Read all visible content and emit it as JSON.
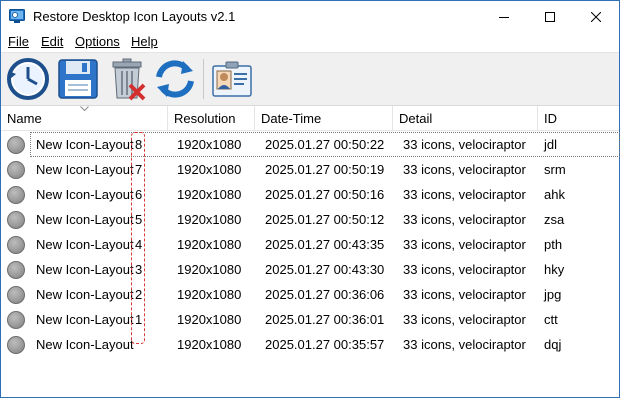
{
  "window": {
    "title": "Restore Desktop Icon Layouts v2.1"
  },
  "menu": {
    "file": "File",
    "edit": "Edit",
    "options": "Options",
    "help": "Help"
  },
  "toolbar": {
    "items": [
      "clock-restore-icon",
      "save-icon",
      "delete-icon",
      "refresh-icon",
      "id-card-icon"
    ]
  },
  "columns": {
    "name": "Name",
    "resolution": "Resolution",
    "datetime": "Date-Time",
    "detail": "Detail",
    "id": "ID"
  },
  "rows": [
    {
      "name": "New Icon-Layout",
      "num": "8",
      "resolution": "1920x1080",
      "datetime": "2025.01.27 00:50:22",
      "detail": "33 icons, velociraptor",
      "id": "jdl"
    },
    {
      "name": "New Icon-Layout",
      "num": "7",
      "resolution": "1920x1080",
      "datetime": "2025.01.27 00:50:19",
      "detail": "33 icons, velociraptor",
      "id": "srm"
    },
    {
      "name": "New Icon-Layout",
      "num": "6",
      "resolution": "1920x1080",
      "datetime": "2025.01.27 00:50:16",
      "detail": "33 icons, velociraptor",
      "id": "ahk"
    },
    {
      "name": "New Icon-Layout",
      "num": "5",
      "resolution": "1920x1080",
      "datetime": "2025.01.27 00:50:12",
      "detail": "33 icons, velociraptor",
      "id": "zsa"
    },
    {
      "name": "New Icon-Layout",
      "num": "4",
      "resolution": "1920x1080",
      "datetime": "2025.01.27 00:43:35",
      "detail": "33 icons, velociraptor",
      "id": "pth"
    },
    {
      "name": "New Icon-Layout",
      "num": "3",
      "resolution": "1920x1080",
      "datetime": "2025.01.27 00:43:30",
      "detail": "33 icons, velociraptor",
      "id": "hky"
    },
    {
      "name": "New Icon-Layout",
      "num": "2",
      "resolution": "1920x1080",
      "datetime": "2025.01.27 00:36:06",
      "detail": "33 icons, velociraptor",
      "id": "jpg"
    },
    {
      "name": "New Icon-Layout",
      "num": "1",
      "resolution": "1920x1080",
      "datetime": "2025.01.27 00:36:01",
      "detail": "33 icons, velociraptor",
      "id": "ctt"
    },
    {
      "name": "New Icon-Layout",
      "num": "",
      "resolution": "1920x1080",
      "datetime": "2025.01.27 00:35:57",
      "detail": "33 icons, velociraptor",
      "id": "dqj"
    }
  ],
  "colors": {
    "accent": "#2f6fb5",
    "highlight_dash": "#d63a3a"
  }
}
